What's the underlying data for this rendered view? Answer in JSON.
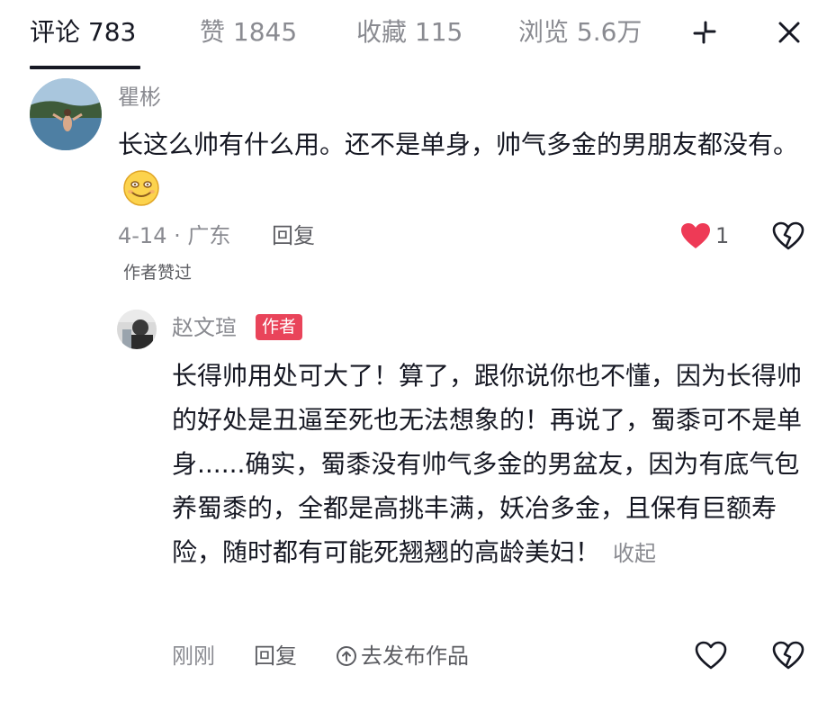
{
  "tabs": [
    {
      "label": "评论 783",
      "active": true
    },
    {
      "label": "赞 1845",
      "active": false
    },
    {
      "label": "收藏 115",
      "active": false
    },
    {
      "label": "浏览 5.6万",
      "active": false
    }
  ],
  "header_icons": [
    "collapse-icon",
    "close-icon"
  ],
  "comment": {
    "username": "瞿彬",
    "text": "长这么帅有什么用。还不是单身，帅气多金的男朋友都没有。",
    "emoji": "smile-emoji",
    "date_location": "4-14 · 广东",
    "reply_label": "回复",
    "like_count": "1",
    "liked": true,
    "liked_by_author_tag": "作者赞过"
  },
  "reply": {
    "username": "赵文瑄",
    "author_badge": "作者",
    "text": "长得帅用处可大了！算了，跟你说你也不懂，因为长得帅的好处是丑逼至死也无法想象的！再说了，蜀黍可不是单身......确实，蜀黍没有帅气多金的男盆友，因为有底气包养蜀黍的，全都是高挑丰满，妖冶多金，且保有巨额寿险，随时都有可能死翘翘的高龄美妇！",
    "collapse_label": "收起",
    "time": "刚刚",
    "reply_label": "回复",
    "share_label": "去发布作品",
    "liked": false
  },
  "colors": {
    "like_red": "#ee3a56",
    "author_badge": "#e9445a",
    "text_primary": "#161823",
    "text_secondary": "#8a8b91"
  }
}
